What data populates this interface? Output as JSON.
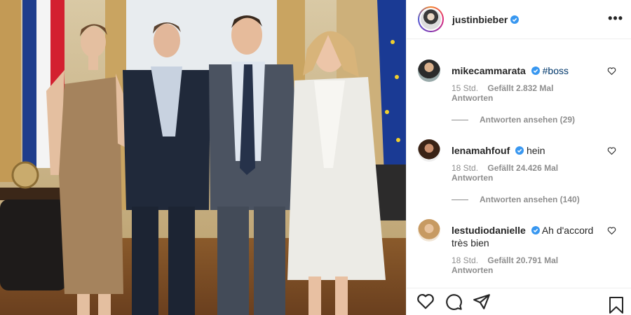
{
  "post": {
    "author": "justinbieber",
    "more_glyph": "•••"
  },
  "comments": [
    {
      "user": "mikecammarata",
      "text": "#boss",
      "time": "15 Std.",
      "likes": "Gefällt 2.832 Mal",
      "reply": "Antworten",
      "view_replies": "Antworten ansehen (29)"
    },
    {
      "user": "lenamahfouf",
      "text": "hein",
      "time": "18 Std.",
      "likes": "Gefällt 24.426 Mal",
      "reply": "Antworten",
      "view_replies": "Antworten ansehen (140)"
    },
    {
      "user": "lestudiodanielle",
      "text": "Ah d'accord",
      "text2": "très bien",
      "time": "18 Std.",
      "likes": "Gefällt 20.791 Mal",
      "reply": "Antworten"
    }
  ],
  "icons": {
    "verified": "verified-badge-icon",
    "heart": "heart-icon",
    "comment": "comment-icon",
    "share": "share-icon",
    "save": "bookmark-icon",
    "more": "more-options-icon"
  },
  "colors": {
    "verified_blue": "#3897f0",
    "hashtag": "#00376b",
    "meta_gray": "#8e8e8e",
    "border": "#efefef"
  }
}
